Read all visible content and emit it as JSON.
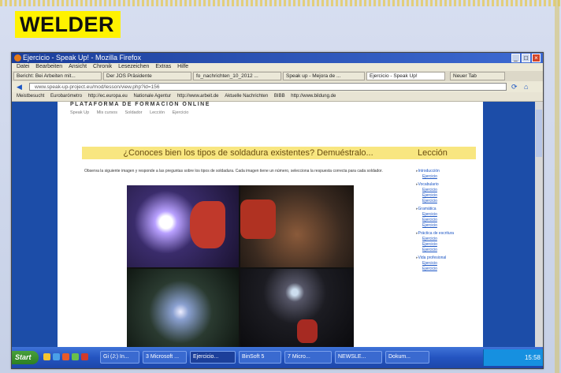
{
  "slide": {
    "title": "WELDER",
    "accent": "#fff200"
  },
  "window": {
    "title": "Ejercicio - Speak Up! - Mozilla Firefox"
  },
  "menu": [
    "Datei",
    "Bearbeiten",
    "Ansicht",
    "Chronik",
    "Lesezeichen",
    "Extras",
    "Hilfe"
  ],
  "tabs": [
    {
      "label": "Bericht: Bei Arbeiten mit..."
    },
    {
      "label": "Der JOS Präsidente"
    },
    {
      "label": "fo_nachrichten_10_2012 ..."
    },
    {
      "label": "Speak up - Mejora de ..."
    },
    {
      "label": "Ejercicio - Speak Up!"
    },
    {
      "label": "Neuer Tab"
    }
  ],
  "url": "www.speak-up-project.eu/mod/lesson/view.php?id=156",
  "bookmarks": [
    "Meistbesucht",
    "Eurobarómetro",
    "http://ec.europa.eu",
    "Nationale Agentur",
    "http://www.arbeit.de",
    "Aktuelle Nachrichten",
    "BIBB",
    "http://www.bildung.de"
  ],
  "page": {
    "brand": "PLATAFORMA DE FORMACION ONLINE",
    "breadcrumb": [
      "Speak Up",
      "Mis cursos",
      "Soldador",
      "Lección",
      "Ejercicio"
    ],
    "headline": "¿Conoces bien los tipos de soldadura existentes? Demuéstralo...",
    "intro": "Observa la siguiente imagen y responde a las preguntas sobre los tipos de soldadura. Cada imagen tiene un número, selecciona la respuesta correcta para cada soldador.",
    "photos": [
      {
        "label": "photo-1"
      },
      {
        "label": "photo-2"
      },
      {
        "label": "photo-3"
      },
      {
        "label": "photo-4"
      }
    ],
    "lesson_title": "Lección",
    "lesson": [
      {
        "top": "Introducción",
        "subs": [
          "Ejercicio"
        ]
      },
      {
        "top": "Vocabulario",
        "subs": [
          "Ejercicio",
          "Ejercicio",
          "Ejercicio"
        ]
      },
      {
        "top": "Gramática",
        "subs": [
          "Ejercicio",
          "Ejercicio",
          "Ejercicio"
        ]
      },
      {
        "top": "Práctica de escritura",
        "subs": [
          "Ejercicio",
          "Ejercicio",
          "Ejercicio"
        ]
      },
      {
        "top": "Vida profesional",
        "subs": [
          "Ejercicio",
          "Ejercicio"
        ]
      }
    ]
  },
  "taskbar": {
    "start": "Start",
    "tasks": [
      "Gi (J:) In...",
      "3 Microsoft ...",
      "Ejercicio...",
      "BinSoft 5",
      "7 Micro...",
      "NEWSLE...",
      "Dokum..."
    ],
    "clock": "15:58"
  }
}
